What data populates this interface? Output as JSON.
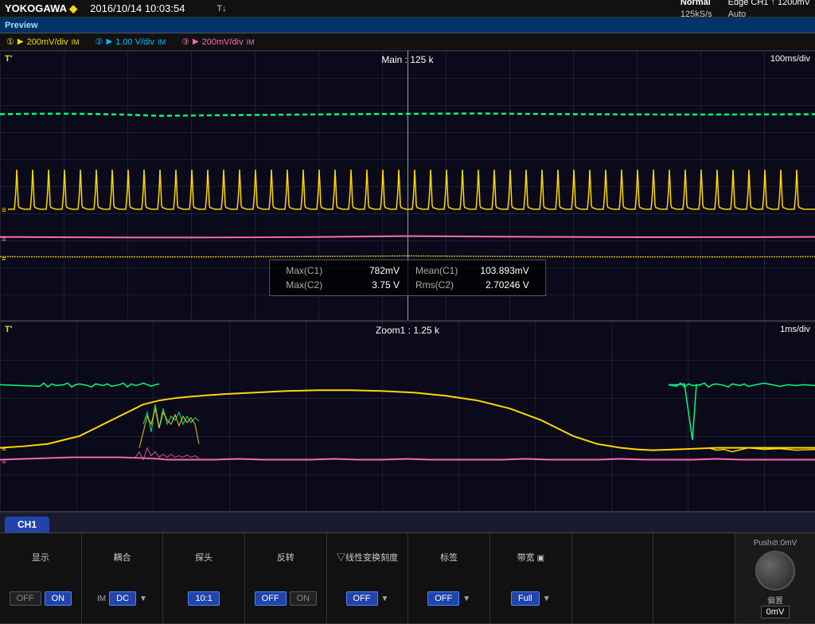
{
  "header": {
    "logo": "YOKOGAWA",
    "diamond": "◆",
    "datetime": "2016/10/14  10:03:54",
    "trigger_marker": "T↓",
    "trigger_mode": "Normal",
    "trigger_rate": "125kS/s",
    "trigger_type": "Edge CH1",
    "trigger_slope": "↑",
    "trigger_level": "1200mV",
    "trigger_auto": "Auto"
  },
  "preview": {
    "label": "Preview"
  },
  "channels": {
    "ch1": {
      "label": "①",
      "scale": "200mV/div",
      "suffix": "IM"
    },
    "ch2": {
      "label": "②",
      "scale": "1.00 V/div",
      "suffix": "IM"
    },
    "ch3": {
      "label": "③",
      "scale": "200mV/div",
      "suffix": "IM"
    }
  },
  "main_scope": {
    "t_label": "T'",
    "main_label": "Main : 125 k",
    "time_div": "100ms/div"
  },
  "zoom_scope": {
    "t_label": "T'",
    "zoom_label": "Zoom1 : 1.25 k",
    "time_div": "1ms/div"
  },
  "measurements": {
    "max_c1_label": "Max(C1)",
    "max_c1_value": "782mV",
    "mean_c1_label": "Mean(C1)",
    "mean_c1_value": "103.893mV",
    "max_c2_label": "Max(C2)",
    "max_c2_value": "3.75 V",
    "rms_c2_label": "Rms(C2)",
    "rms_c2_value": "2.70246 V"
  },
  "bottom": {
    "active_channel": "CH1",
    "controls": [
      {
        "id": "display",
        "label": "显示",
        "options": [
          "OFF",
          "ON"
        ],
        "active": "ON"
      },
      {
        "id": "coupling",
        "label": "耦合",
        "options": [
          "DC"
        ],
        "active": "DC",
        "has_arrow": true
      },
      {
        "id": "probe",
        "label": "探头",
        "options": [
          "10:1"
        ],
        "active": "10:1"
      },
      {
        "id": "invert",
        "label": "反转",
        "options": [
          "OFF",
          "ON"
        ],
        "active": "OFF"
      },
      {
        "id": "linear",
        "label": "线性变换刻度",
        "options": [
          "OFF"
        ],
        "active": "OFF",
        "has_arrow_prefix": true
      },
      {
        "id": "label",
        "label": "标签",
        "options": [
          "OFF"
        ],
        "active": "OFF",
        "has_arrow": true
      },
      {
        "id": "bandwidth",
        "label": "带宽",
        "extra": "▣",
        "options": [
          "Full"
        ],
        "active": "Full",
        "has_arrow": true
      }
    ],
    "knob": {
      "push_label": "Push⊘:0mV",
      "knob_label": "偏置",
      "value": "0mV"
    }
  },
  "colors": {
    "ch1": "#FFD700",
    "ch2": "#00BFFF",
    "ch3": "#FF69B4",
    "ch4": "#00FF7F",
    "grid": "#2a2a4a",
    "background": "#000810",
    "scope_bg": "#000810"
  }
}
